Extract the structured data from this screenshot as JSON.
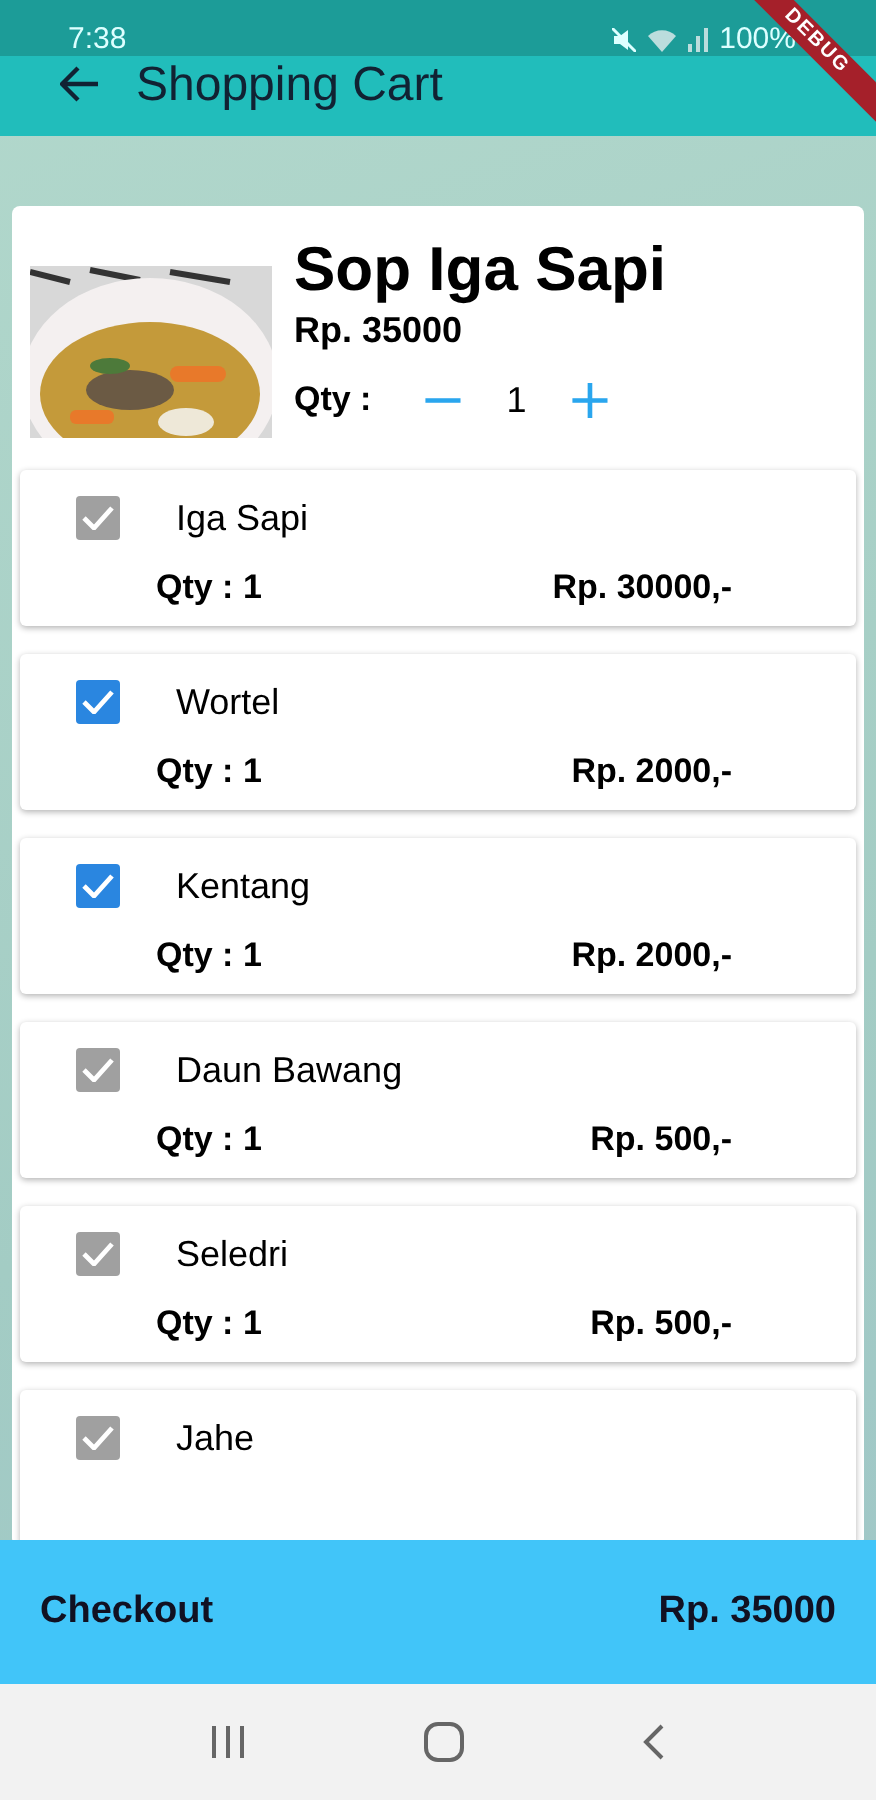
{
  "status_bar": {
    "time": "7:38",
    "battery": "100%"
  },
  "debug_banner": "DEBUG",
  "app_bar": {
    "title": "Shopping Cart"
  },
  "product": {
    "kind": "picture",
    "name": "Sop Iga Sapi",
    "price": "Rp. 35000",
    "qty_label": "Qty :",
    "qty": "1",
    "minus": "−",
    "plus": "+"
  },
  "ingredients": [
    {
      "name": "Iga Sapi",
      "qty": "Qty : 1",
      "price": "Rp. 30000,-",
      "checked": true,
      "disabled": true
    },
    {
      "name": "Wortel",
      "qty": "Qty : 1",
      "price": "Rp. 2000,-",
      "checked": true,
      "disabled": false
    },
    {
      "name": "Kentang",
      "qty": "Qty : 1",
      "price": "Rp. 2000,-",
      "checked": true,
      "disabled": false
    },
    {
      "name": "Daun Bawang",
      "qty": "Qty : 1",
      "price": "Rp. 500,-",
      "checked": true,
      "disabled": true
    },
    {
      "name": "Seledri",
      "qty": "Qty : 1",
      "price": "Rp. 500,-",
      "checked": true,
      "disabled": true
    },
    {
      "name": "Jahe",
      "checked": true,
      "disabled": true
    }
  ],
  "checkout_bar": {
    "label": "Checkout",
    "total": "Rp. 35000"
  }
}
